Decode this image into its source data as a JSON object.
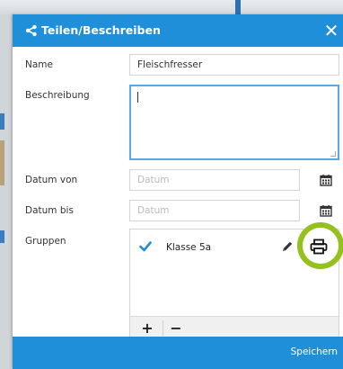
{
  "dialog": {
    "title": "Teilen/Beschreiben",
    "close_label": "✕"
  },
  "form": {
    "name_label": "Name",
    "name_value": "Fleischfresser",
    "description_label": "Beschreibung",
    "description_value": "",
    "date_from_label": "Datum von",
    "date_from_placeholder": "Datum",
    "date_to_label": "Datum bis",
    "date_to_placeholder": "Datum",
    "groups_label": "Gruppen"
  },
  "groups": {
    "items": [
      {
        "label": "Klasse 5a",
        "checked": true
      }
    ],
    "add_label": "+",
    "remove_label": "−"
  },
  "footer": {
    "save_label": "Speichern"
  },
  "colors": {
    "accent": "#1e8fd8",
    "highlight": "#95c11f"
  }
}
